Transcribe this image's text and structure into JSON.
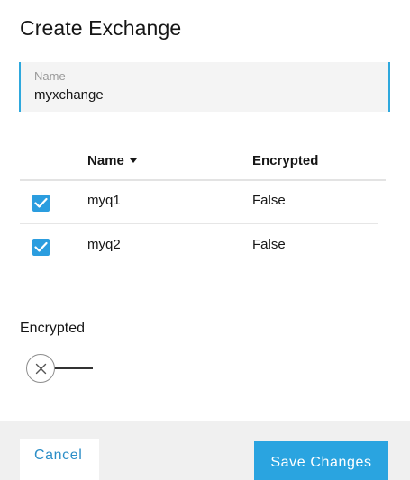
{
  "dialog": {
    "title": "Create Exchange"
  },
  "name_field": {
    "label": "Name",
    "value": "myxchange"
  },
  "table": {
    "columns": {
      "name": "Name",
      "encrypted": "Encrypted"
    },
    "sort_indicator": "caret-down-icon",
    "rows": [
      {
        "checked": true,
        "name": "myq1",
        "encrypted": "False"
      },
      {
        "checked": true,
        "name": "myq2",
        "encrypted": "False"
      }
    ]
  },
  "encrypted_toggle": {
    "label": "Encrypted",
    "state": "off",
    "icon": "close-icon"
  },
  "footer": {
    "cancel_label": "Cancel",
    "save_label": "Save Changes"
  },
  "colors": {
    "accent": "#2aa4e0",
    "checkbox": "#2b9ddf",
    "link": "#2b8ec7",
    "footer_bg": "#f0f0f0",
    "field_bg": "#f4f4f4"
  }
}
